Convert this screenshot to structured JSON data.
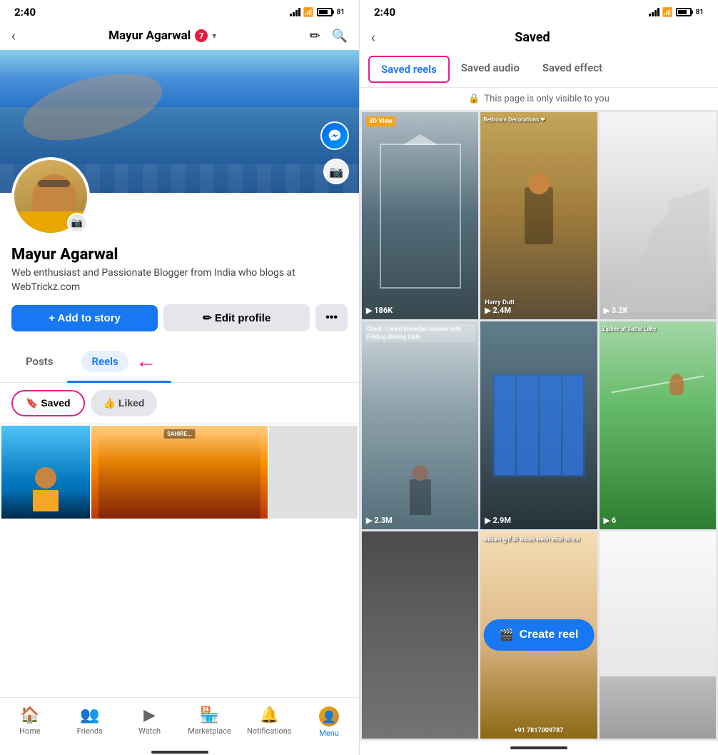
{
  "left_phone": {
    "status_bar": {
      "time": "2:40",
      "battery": "81"
    },
    "header": {
      "back_label": "‹",
      "name": "Mayur Agarwal",
      "notification_count": "7",
      "edit_icon": "✏",
      "search_icon": "🔍"
    },
    "profile": {
      "name": "Mayur Agarwal",
      "bio": "Web enthusiast and Passionate Blogger from India who blogs at WebTrickz.com"
    },
    "buttons": {
      "add_story": "+ Add to story",
      "edit_profile": "✏ Edit profile",
      "more": "•••"
    },
    "tabs": {
      "posts": "Posts",
      "reels": "Reels"
    },
    "filter_tabs": {
      "saved": "🔖 Saved",
      "liked": "👍 Liked"
    },
    "bottom_nav": [
      {
        "icon": "🏠",
        "label": "Home"
      },
      {
        "icon": "👥",
        "label": "Friends"
      },
      {
        "icon": "▶",
        "label": "Watch"
      },
      {
        "icon": "🏪",
        "label": "Marketplace"
      },
      {
        "icon": "🔔",
        "label": "Notifications"
      },
      {
        "icon": "👤",
        "label": "Menu"
      }
    ]
  },
  "right_phone": {
    "status_bar": {
      "time": "2:40",
      "battery": "81"
    },
    "header": {
      "back_label": "‹",
      "title": "Saved"
    },
    "tabs": [
      {
        "label": "Saved reels",
        "active": true
      },
      {
        "label": "Saved audio",
        "active": false
      },
      {
        "label": "Saved effect",
        "active": false
      }
    ],
    "visibility_note": "🔒 This page is only visible to you",
    "reels": [
      {
        "id": 1,
        "caption": "3D View",
        "play_count": "▶ 186K",
        "bg": "rb1"
      },
      {
        "id": 2,
        "caption": "Bedroom Decorations ❤",
        "play_count": "▶ 2.4M",
        "name": "Harry Dutt",
        "bg": "rb2"
      },
      {
        "id": 3,
        "caption": "",
        "play_count": "▶ 3.2K",
        "bg": "rb3"
      },
      {
        "id": 4,
        "caption": "Client - I want breakfast counter with Folding dinning table",
        "play_count": "▶ 2.3M",
        "bg": "rb4"
      },
      {
        "id": 5,
        "caption": "",
        "play_count": "▶ 2.9M",
        "bg": "rb5"
      },
      {
        "id": 6,
        "caption": "Zipline at Sattal Lake",
        "play_count": "▶ 6",
        "bg": "rb6"
      },
      {
        "id": 7,
        "caption": "",
        "play_count": "",
        "bg": "rb7"
      },
      {
        "id": 8,
        "caption": "अफ्रीकन मुर्गों की भयंकार सम्मोग शक्ति का राज",
        "play_count": "+91 7817009787",
        "bg": "rb8"
      },
      {
        "id": 9,
        "caption": "",
        "play_count": "",
        "bg": "rb9"
      }
    ],
    "create_reel_btn": "🎬 Create reel"
  }
}
